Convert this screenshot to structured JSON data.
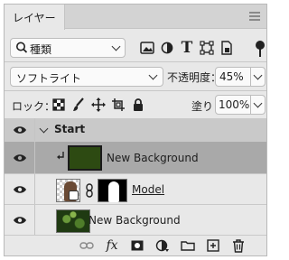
{
  "panel": {
    "tab_label": "レイヤー"
  },
  "filter": {
    "kind_label": "種類",
    "icons": [
      "image-filter-icon",
      "adjustment-filter-icon",
      "type-filter-icon",
      "shape-filter-icon",
      "smart-object-filter-icon"
    ]
  },
  "blend": {
    "mode": "ソフトライト",
    "opacity_label": "不透明度：",
    "opacity_value": "45%"
  },
  "lock": {
    "label": "ロック：",
    "icons": [
      "lock-transparent-pixels-icon",
      "lock-image-pixels-icon",
      "lock-position-icon",
      "lock-artboard-icon",
      "lock-all-icon"
    ],
    "fill_label": "塗り：",
    "fill_value": "100%"
  },
  "layers": {
    "group": {
      "name": "Start",
      "expanded": true
    },
    "items": [
      {
        "name": "New Background",
        "kind": "solid-color-fill",
        "color": "#2d4a12",
        "clipped": true,
        "selected": true,
        "visible": true
      },
      {
        "name": "Model",
        "kind": "smart-object-with-mask",
        "visible": true
      },
      {
        "name": "New Background",
        "kind": "image",
        "visible": true
      }
    ]
  },
  "footer": {
    "icons": [
      "link-layers-icon",
      "fx-icon",
      "add-mask-icon",
      "adjustment-layer-icon",
      "new-group-icon",
      "new-layer-icon",
      "delete-layer-icon"
    ],
    "fx_label": "fx"
  },
  "colors": {
    "panel_bg": "#e8e8e8",
    "group_row_bg": "#c9c9c9",
    "selected_row_bg": "#a9a9a9",
    "fill_color": "#2d4a12"
  }
}
